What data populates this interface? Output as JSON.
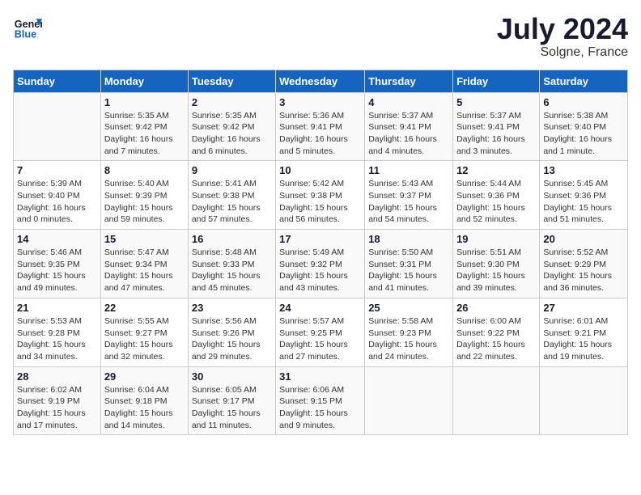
{
  "logo": {
    "line1": "General",
    "line2": "Blue"
  },
  "title": "July 2024",
  "location": "Solgne, France",
  "days_header": [
    "Sunday",
    "Monday",
    "Tuesday",
    "Wednesday",
    "Thursday",
    "Friday",
    "Saturday"
  ],
  "weeks": [
    [
      {
        "day": "",
        "info": ""
      },
      {
        "day": "1",
        "info": "Sunrise: 5:35 AM\nSunset: 9:42 PM\nDaylight: 16 hours\nand 7 minutes."
      },
      {
        "day": "2",
        "info": "Sunrise: 5:35 AM\nSunset: 9:42 PM\nDaylight: 16 hours\nand 6 minutes."
      },
      {
        "day": "3",
        "info": "Sunrise: 5:36 AM\nSunset: 9:41 PM\nDaylight: 16 hours\nand 5 minutes."
      },
      {
        "day": "4",
        "info": "Sunrise: 5:37 AM\nSunset: 9:41 PM\nDaylight: 16 hours\nand 4 minutes."
      },
      {
        "day": "5",
        "info": "Sunrise: 5:37 AM\nSunset: 9:41 PM\nDaylight: 16 hours\nand 3 minutes."
      },
      {
        "day": "6",
        "info": "Sunrise: 5:38 AM\nSunset: 9:40 PM\nDaylight: 16 hours\nand 1 minute."
      }
    ],
    [
      {
        "day": "7",
        "info": "Sunrise: 5:39 AM\nSunset: 9:40 PM\nDaylight: 16 hours\nand 0 minutes."
      },
      {
        "day": "8",
        "info": "Sunrise: 5:40 AM\nSunset: 9:39 PM\nDaylight: 15 hours\nand 59 minutes."
      },
      {
        "day": "9",
        "info": "Sunrise: 5:41 AM\nSunset: 9:38 PM\nDaylight: 15 hours\nand 57 minutes."
      },
      {
        "day": "10",
        "info": "Sunrise: 5:42 AM\nSunset: 9:38 PM\nDaylight: 15 hours\nand 56 minutes."
      },
      {
        "day": "11",
        "info": "Sunrise: 5:43 AM\nSunset: 9:37 PM\nDaylight: 15 hours\nand 54 minutes."
      },
      {
        "day": "12",
        "info": "Sunrise: 5:44 AM\nSunset: 9:36 PM\nDaylight: 15 hours\nand 52 minutes."
      },
      {
        "day": "13",
        "info": "Sunrise: 5:45 AM\nSunset: 9:36 PM\nDaylight: 15 hours\nand 51 minutes."
      }
    ],
    [
      {
        "day": "14",
        "info": "Sunrise: 5:46 AM\nSunset: 9:35 PM\nDaylight: 15 hours\nand 49 minutes."
      },
      {
        "day": "15",
        "info": "Sunrise: 5:47 AM\nSunset: 9:34 PM\nDaylight: 15 hours\nand 47 minutes."
      },
      {
        "day": "16",
        "info": "Sunrise: 5:48 AM\nSunset: 9:33 PM\nDaylight: 15 hours\nand 45 minutes."
      },
      {
        "day": "17",
        "info": "Sunrise: 5:49 AM\nSunset: 9:32 PM\nDaylight: 15 hours\nand 43 minutes."
      },
      {
        "day": "18",
        "info": "Sunrise: 5:50 AM\nSunset: 9:31 PM\nDaylight: 15 hours\nand 41 minutes."
      },
      {
        "day": "19",
        "info": "Sunrise: 5:51 AM\nSunset: 9:30 PM\nDaylight: 15 hours\nand 39 minutes."
      },
      {
        "day": "20",
        "info": "Sunrise: 5:52 AM\nSunset: 9:29 PM\nDaylight: 15 hours\nand 36 minutes."
      }
    ],
    [
      {
        "day": "21",
        "info": "Sunrise: 5:53 AM\nSunset: 9:28 PM\nDaylight: 15 hours\nand 34 minutes."
      },
      {
        "day": "22",
        "info": "Sunrise: 5:55 AM\nSunset: 9:27 PM\nDaylight: 15 hours\nand 32 minutes."
      },
      {
        "day": "23",
        "info": "Sunrise: 5:56 AM\nSunset: 9:26 PM\nDaylight: 15 hours\nand 29 minutes."
      },
      {
        "day": "24",
        "info": "Sunrise: 5:57 AM\nSunset: 9:25 PM\nDaylight: 15 hours\nand 27 minutes."
      },
      {
        "day": "25",
        "info": "Sunrise: 5:58 AM\nSunset: 9:23 PM\nDaylight: 15 hours\nand 24 minutes."
      },
      {
        "day": "26",
        "info": "Sunrise: 6:00 AM\nSunset: 9:22 PM\nDaylight: 15 hours\nand 22 minutes."
      },
      {
        "day": "27",
        "info": "Sunrise: 6:01 AM\nSunset: 9:21 PM\nDaylight: 15 hours\nand 19 minutes."
      }
    ],
    [
      {
        "day": "28",
        "info": "Sunrise: 6:02 AM\nSunset: 9:19 PM\nDaylight: 15 hours\nand 17 minutes."
      },
      {
        "day": "29",
        "info": "Sunrise: 6:04 AM\nSunset: 9:18 PM\nDaylight: 15 hours\nand 14 minutes."
      },
      {
        "day": "30",
        "info": "Sunrise: 6:05 AM\nSunset: 9:17 PM\nDaylight: 15 hours\nand 11 minutes."
      },
      {
        "day": "31",
        "info": "Sunrise: 6:06 AM\nSunset: 9:15 PM\nDaylight: 15 hours\nand 9 minutes."
      },
      {
        "day": "",
        "info": ""
      },
      {
        "day": "",
        "info": ""
      },
      {
        "day": "",
        "info": ""
      }
    ]
  ]
}
